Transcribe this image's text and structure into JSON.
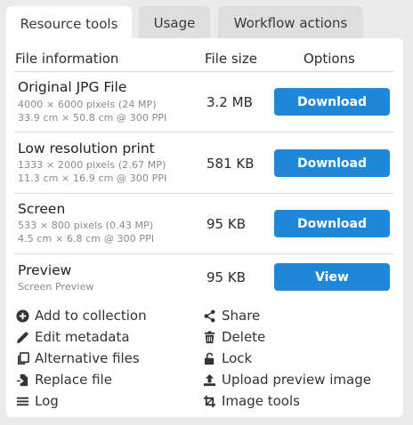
{
  "tabs": [
    {
      "label": "Resource tools",
      "active": true
    },
    {
      "label": "Usage",
      "active": false
    },
    {
      "label": "Workflow actions",
      "active": false
    }
  ],
  "table": {
    "headers": {
      "info": "File information",
      "size": "File size",
      "options": "Options"
    },
    "rows": [
      {
        "title": "Original JPG File",
        "line1": "4000 × 6000 pixels (24 MP)",
        "line2": "33.9 cm × 50.8 cm @ 300 PPI",
        "size": "3.2 MB",
        "action": "Download"
      },
      {
        "title": "Low resolution print",
        "line1": "1333 × 2000 pixels (2.67 MP)",
        "line2": "11.3 cm × 16.9 cm @ 300 PPI",
        "size": "581 KB",
        "action": "Download"
      },
      {
        "title": "Screen",
        "line1": "533 × 800 pixels (0.43 MP)",
        "line2": "4.5 cm × 6.8 cm @ 300 PPI",
        "size": "95 KB",
        "action": "Download"
      },
      {
        "title": "Preview",
        "line1": "Screen Preview",
        "line2": "",
        "size": "95 KB",
        "action": "View"
      }
    ]
  },
  "actions": {
    "left": [
      {
        "label": "Add to collection",
        "icon": "plus-circle-icon"
      },
      {
        "label": "Edit metadata",
        "icon": "pencil-icon"
      },
      {
        "label": "Alternative files",
        "icon": "copy-files-icon"
      },
      {
        "label": "Replace file",
        "icon": "file-import-icon"
      },
      {
        "label": "Log",
        "icon": "list-icon"
      }
    ],
    "right": [
      {
        "label": "Share",
        "icon": "share-icon"
      },
      {
        "label": "Delete",
        "icon": "trash-icon"
      },
      {
        "label": "Lock",
        "icon": "unlock-icon"
      },
      {
        "label": "Upload preview image",
        "icon": "upload-icon"
      },
      {
        "label": "Image tools",
        "icon": "crop-icon"
      }
    ]
  },
  "colors": {
    "accent": "#1f87d9",
    "background": "#ebebeb",
    "panel": "#ffffff",
    "tab_inactive": "#dedede"
  }
}
